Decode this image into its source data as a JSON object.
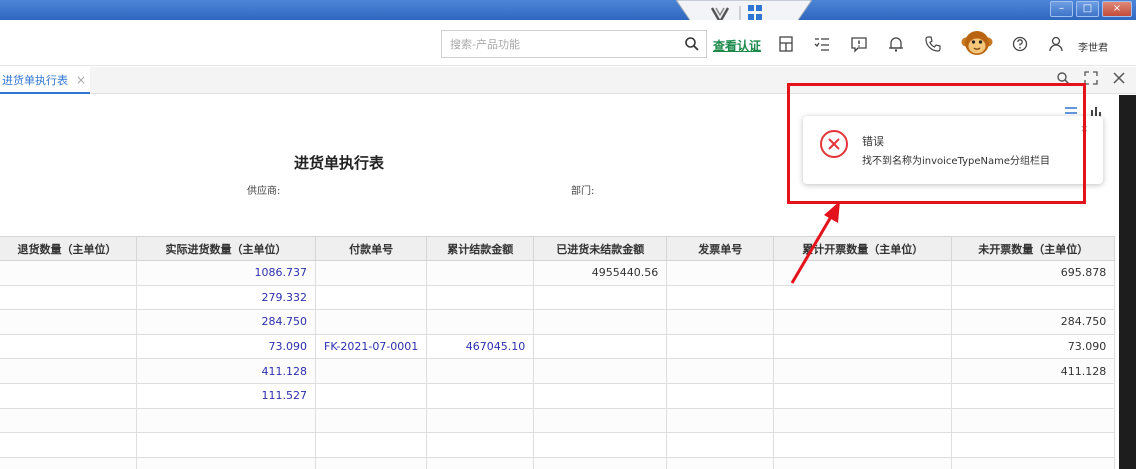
{
  "toolbar": {
    "search_placeholder": "搜索-产品功能",
    "verify_label": "查看认证",
    "username": "李世君",
    "icons": [
      "search-icon",
      "calculator-icon",
      "checklist-icon",
      "message-icon",
      "bell-icon",
      "phone-icon",
      "avatar-icon",
      "help-icon",
      "user-icon"
    ]
  },
  "tabs": [
    {
      "label": "进货单执行表",
      "active": true
    }
  ],
  "report": {
    "title": "进货单执行表",
    "supplier_label": "供应商:",
    "department_label": "部门:",
    "columns": [
      "退货数量（主单位）",
      "实际进货数量（主单位）",
      "付款单号",
      "累计结款金额",
      "已进货未结款金额",
      "发票单号",
      "累计开票数量（主单位）",
      "未开票数量（主单位）"
    ],
    "rows": [
      [
        "",
        "1086.737",
        "",
        "",
        "4955440.56",
        "",
        "",
        "695.878"
      ],
      [
        "",
        "279.332",
        "",
        "",
        "",
        "",
        "",
        ""
      ],
      [
        "",
        "284.750",
        "",
        "",
        "",
        "",
        "",
        "284.750"
      ],
      [
        "",
        "73.090",
        "FK-2021-07-0001",
        "467045.10",
        "",
        "",
        "",
        "73.090"
      ],
      [
        "",
        "411.128",
        "",
        "",
        "",
        "",
        "",
        "411.128"
      ],
      [
        "",
        "111.527",
        "",
        "",
        "",
        "",
        "",
        ""
      ],
      [
        "",
        "",
        "",
        "",
        "",
        "",
        "",
        ""
      ],
      [
        "",
        "",
        "",
        "",
        "",
        "",
        "",
        ""
      ],
      [
        "",
        "",
        "",
        "",
        "",
        "",
        "",
        ""
      ]
    ]
  },
  "toast": {
    "title": "错误",
    "message": "找不到名称为invoiceTypeName分组栏目",
    "type": "error"
  },
  "colors": {
    "accent": "#2f76d2",
    "highlight": "#e4121a",
    "verify": "#1c8a4a",
    "value_blue": "#2d2fae"
  }
}
